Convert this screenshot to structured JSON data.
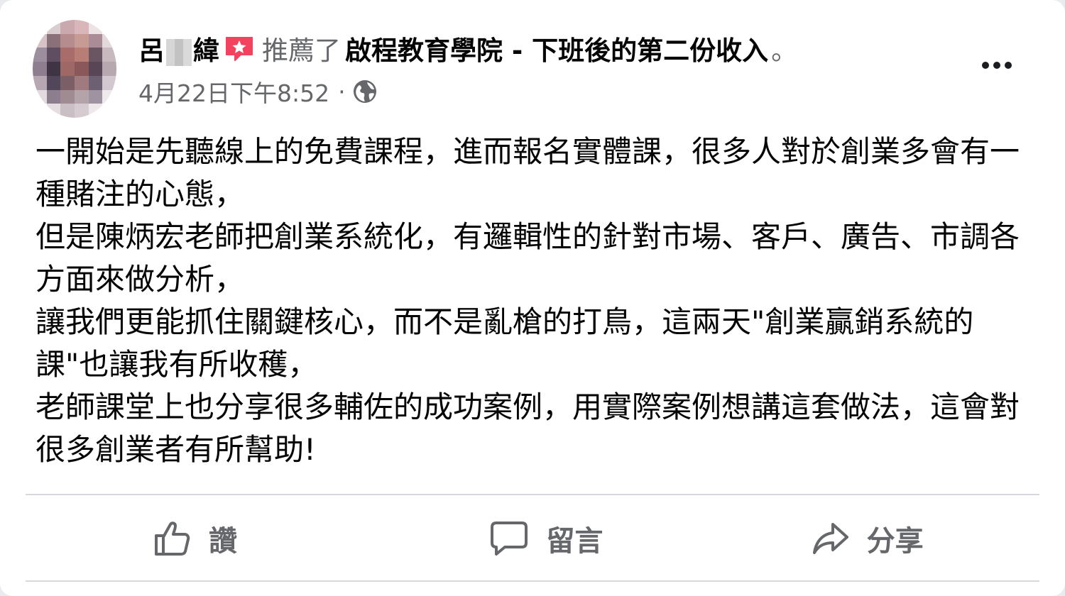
{
  "post": {
    "author": {
      "name_first": "呂",
      "name_last": "緯",
      "avatar_colors": [
        "#c6b3b8",
        "#a88991",
        "#8b6c70",
        "#9e7f86",
        "#b9a3a8",
        "#d8cbcd"
      ]
    },
    "action_text": "推薦了",
    "page_name": "啟程教育學院 - 下班後的第二份收入",
    "period": "。",
    "timestamp": "4月22日下午8:52",
    "meta_separator": "·",
    "badge_color": "#f3425f",
    "paragraphs": [
      "一開始是先聽線上的免費課程，進而報名實體課，很多人對於創業多會有一種賭注的心態，",
      "但是陳炳宏老師把創業系統化，有邏輯性的針對市場、客戶、廣告、市調各方面來做分析，",
      "讓我們更能抓住關鍵核心，而不是亂槍的打鳥，這兩天\"創業贏銷系統的課\"也讓我有所收穫，",
      "老師課堂上也分享很多輔佐的成功案例，用實際案例想講這套做法，這會對很多創業者有所幫助!"
    ]
  },
  "actions": {
    "like_label": "讚",
    "comment_label": "留言",
    "share_label": "分享"
  },
  "icons": {
    "badge": "recommend-star-icon",
    "privacy": "globe-icon",
    "more": "more-dots-icon",
    "like": "thumbs-up-icon",
    "comment": "comment-bubble-icon",
    "share": "share-arrow-icon"
  }
}
